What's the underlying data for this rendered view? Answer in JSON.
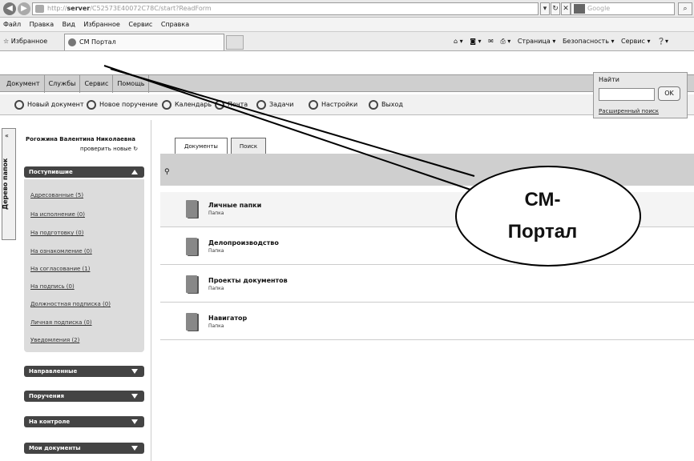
{
  "browser": {
    "url_prefix": "http://",
    "url_host": "server",
    "url_path": "/C52573E40072C78C/start?ReadForm",
    "search_placeholder": "Google"
  },
  "menu": [
    "Файл",
    "Правка",
    "Вид",
    "Избранное",
    "Сервис",
    "Справка"
  ],
  "favorites": {
    "label": "Избранное",
    "tab_title": "СМ Портал",
    "commands": [
      "Страница ▾",
      "Безопасность ▾",
      "Сервис ▾"
    ]
  },
  "app_menu": [
    "Документ",
    "Службы",
    "Сервис",
    "Помощь"
  ],
  "toolbar": [
    "Новый документ",
    "Новое поручение",
    "Календарь",
    "Почта",
    "Задачи",
    "Настройки",
    "Выход"
  ],
  "find": {
    "label": "Найти",
    "ok": "OK",
    "advanced": "Расширенный поиск"
  },
  "sidebar": {
    "vertical_tab": "Дерево папок",
    "user": "Рогожина Валентина Николаевна",
    "check_new": "проверить новые",
    "inbox_title": "Поступившие",
    "inbox_items": [
      "Адресованные (5)",
      "На исполнение (0)",
      "На подготовку (0)",
      "На ознакомление (0)",
      "На согласование (1)",
      "На подпись (0)",
      "Должностная подписка (0)",
      "Личная подписка (0)",
      "Уведомления (2)"
    ],
    "sections": [
      "Направленные",
      "Поручения",
      "На контроле",
      "Мои документы"
    ]
  },
  "main": {
    "tabs": [
      "Документы",
      "Поиск"
    ],
    "folders": [
      {
        "name": "Личные папки",
        "type": "Папка"
      },
      {
        "name": "Делопроизводство",
        "type": "Папка"
      },
      {
        "name": "Проекты документов",
        "type": "Папка"
      },
      {
        "name": "Навигатор",
        "type": "Папка"
      }
    ]
  },
  "callout": {
    "line1": "СМ-",
    "line2": "Портал"
  }
}
